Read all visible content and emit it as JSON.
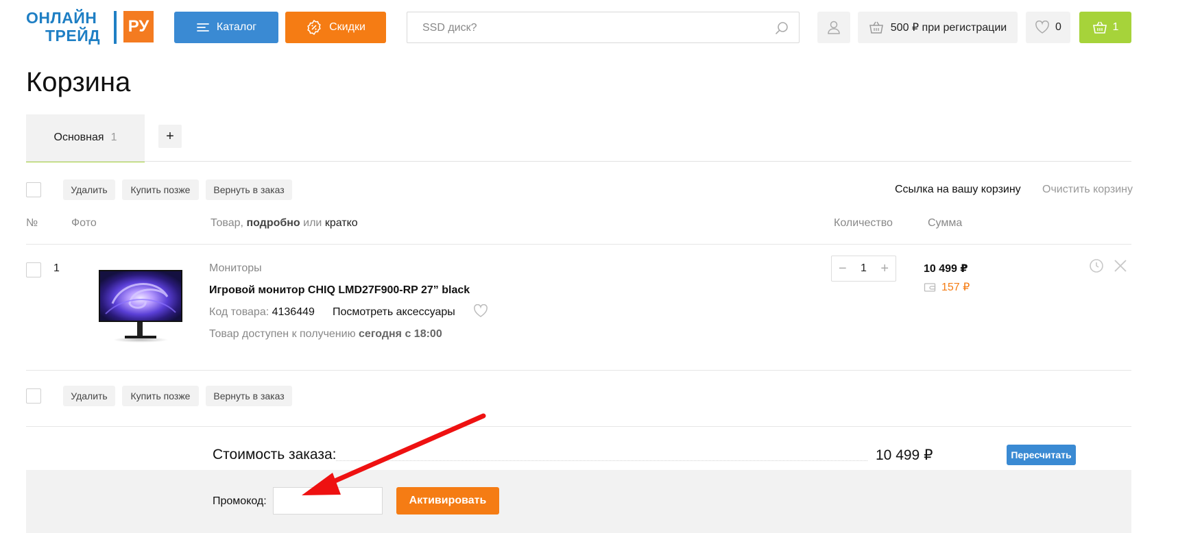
{
  "header": {
    "logo_line1": "ОНЛАЙН",
    "logo_line2": "ТРЕЙД",
    "logo_badge": "РУ",
    "catalog_label": "Каталог",
    "sales_label": "Скидки",
    "search_placeholder": "SSD диск?",
    "promo_label": "500 ₽ при регистрации",
    "favorites_count": "0",
    "cart_count": "1",
    "colors": {
      "brand_blue": "#3a8ad3",
      "brand_orange": "#f57c14",
      "cart_green": "#a6d33a"
    }
  },
  "page": {
    "title": "Корзина",
    "tabs": [
      {
        "label": "Основная",
        "count": "1"
      }
    ],
    "tab_add_label": "+"
  },
  "actions": {
    "delete": "Удалить",
    "buy_later": "Купить позже",
    "return_to_order": "Вернуть в заказ",
    "cart_link": "Ссылка на вашу корзину",
    "clear_cart": "Очистить корзину"
  },
  "table_header": {
    "num": "№",
    "photo": "Фото",
    "product_prefix": "Товар,",
    "product_detailed": "подробно",
    "product_or": "или",
    "product_brief": "кратко",
    "quantity": "Количество",
    "sum": "Сумма"
  },
  "items": [
    {
      "index": "1",
      "category": "Мониторы",
      "name": "Игровой монитор CHIQ LMD27F900-RP 27” black",
      "code_label": "Код товара:",
      "code": "4136449",
      "accessories": "Посмотреть аксессуары",
      "availability_prefix": "Товар доступен к получению",
      "availability_time": "сегодня с 18:00",
      "quantity": "1",
      "price": "10 499 ₽",
      "bonus": "157 ₽"
    }
  ],
  "summary": {
    "label": "Стоимость заказа:",
    "value": "10 499 ₽",
    "recalc": "Пересчитать",
    "promo_label": "Промокод:",
    "activate": "Активировать"
  }
}
